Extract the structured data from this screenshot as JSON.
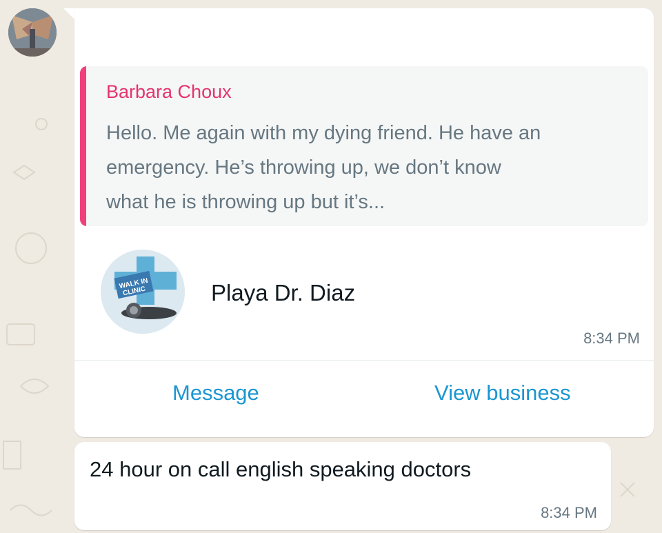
{
  "forwarded_card": {
    "quote": {
      "author": "Barbara Choux",
      "text": "Hello. Me again with my dying friend. He have an emergency. He’s throwing up, we don’t know what he is throwing up but it’s..."
    },
    "contact": {
      "name": "Playa Dr. Diaz",
      "logo_text_line1": "WALK IN",
      "logo_text_line2": "CLINIC"
    },
    "time": "8:34 PM",
    "actions": {
      "message": "Message",
      "view_business": "View business"
    }
  },
  "message2": {
    "text": "24 hour on call english speaking doctors",
    "time": "8:34 PM"
  },
  "colors": {
    "quote_author": "#e4336f",
    "link": "#1a96d1",
    "chat_background": "#efeae2"
  }
}
